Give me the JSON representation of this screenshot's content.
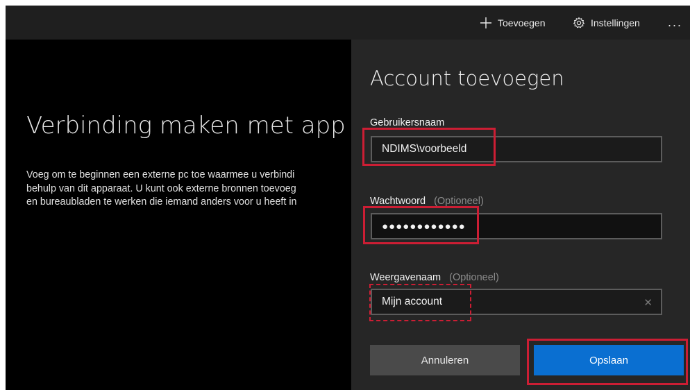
{
  "toolbar": {
    "add_label": "Toevoegen",
    "settings_label": "Instellingen",
    "more_label": "..."
  },
  "hero": {
    "title": "Verbinding maken met app",
    "description": "Voeg om te beginnen een externe pc toe waarmee u verbindi\nbehulp van dit apparaat. U kunt ook externe bronnen toevoeg\nen bureaubladen te werken die iemand anders voor u heeft in"
  },
  "panel": {
    "title": "Account toevoegen",
    "username": {
      "label": "Gebruikersnaam",
      "value": "NDIMS\\voorbeeld"
    },
    "password": {
      "label": "Wachtwoord",
      "optional": "(Optioneel)",
      "value": "●●●●●●●●●●●●"
    },
    "display_name": {
      "label": "Weergavenaam",
      "optional": "(Optioneel)",
      "value": "Mijn account"
    },
    "cancel_label": "Annuleren",
    "save_label": "Opslaan"
  },
  "colors": {
    "accent": "#0a6fd1",
    "annotation": "#cc1e34",
    "panel_bg": "#262626",
    "background": "#000000"
  },
  "icons": [
    "plus-icon",
    "gear-icon",
    "clear-icon"
  ]
}
